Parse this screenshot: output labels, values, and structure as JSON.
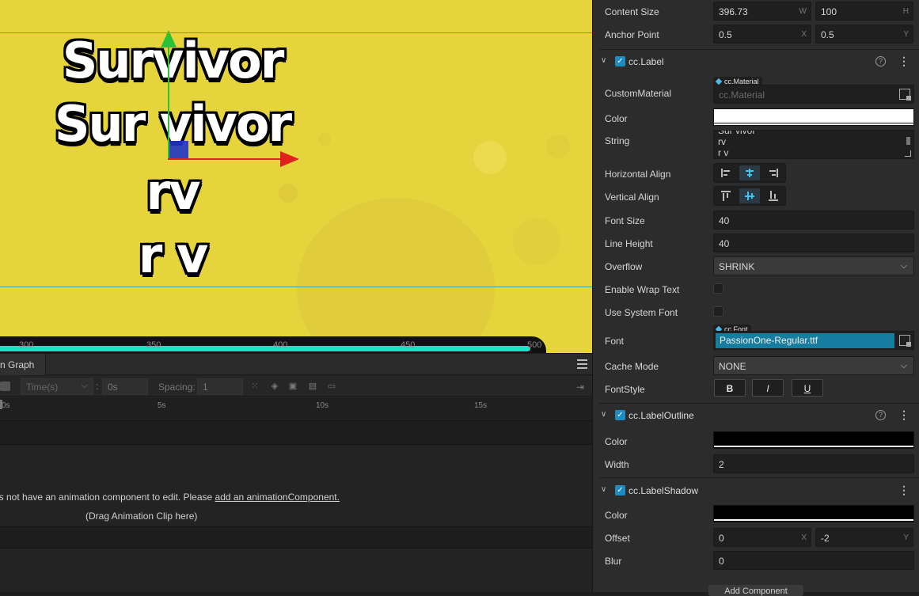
{
  "scene": {
    "label_lines": [
      "Survivor",
      "Sur vivor",
      "rv",
      "r v"
    ],
    "ruler_ticks": [
      "300",
      "350",
      "400",
      "450",
      "500"
    ]
  },
  "animation": {
    "tab_label": "n Graph",
    "time_mode": "Time(s)",
    "time_value": "0s",
    "spacing_label": "Spacing:",
    "spacing_value": "1",
    "timeline_labels": [
      "0s",
      "5s",
      "10s",
      "15s"
    ],
    "message_prefix": "es not have an animation component to edit. Please ",
    "message_link": "add an animationComponent.",
    "drag_hint": "(Drag Animation Clip here)"
  },
  "inspector": {
    "content_size": {
      "label": "Content Size",
      "width": "396.73",
      "width_suffix": "W",
      "height": "100",
      "height_suffix": "H"
    },
    "anchor_point": {
      "label": "Anchor Point",
      "x": "0.5",
      "x_suffix": "X",
      "y": "0.5",
      "y_suffix": "Y"
    },
    "label_component": {
      "title": "cc.Label",
      "custom_material": {
        "label": "CustomMaterial",
        "tag": "cc.Material",
        "value": "cc.Material"
      },
      "color": {
        "label": "Color",
        "value": "#ffffff"
      },
      "string": {
        "label": "String",
        "lines": [
          "Sur vivor",
          "rv",
          "r v"
        ]
      },
      "horizontal_align": {
        "label": "Horizontal Align",
        "selected": "center"
      },
      "vertical_align": {
        "label": "Vertical Align",
        "selected": "center"
      },
      "font_size": {
        "label": "Font Size",
        "value": "40"
      },
      "line_height": {
        "label": "Line Height",
        "value": "40"
      },
      "overflow": {
        "label": "Overflow",
        "value": "SHRINK"
      },
      "enable_wrap_text": {
        "label": "Enable Wrap Text",
        "checked": false
      },
      "use_system_font": {
        "label": "Use System Font",
        "checked": false
      },
      "font": {
        "label": "Font",
        "tag": "cc.Font",
        "value": "PassionOne-Regular.ttf"
      },
      "cache_mode": {
        "label": "Cache Mode",
        "value": "NONE"
      },
      "font_style": {
        "label": "FontStyle",
        "bold": "B",
        "italic": "I",
        "underline": "U"
      }
    },
    "label_outline": {
      "title": "cc.LabelOutline",
      "color": {
        "label": "Color",
        "value": "#000000"
      },
      "width": {
        "label": "Width",
        "value": "2"
      }
    },
    "label_shadow": {
      "title": "cc.LabelShadow",
      "color": {
        "label": "Color",
        "value": "#000000"
      },
      "offset": {
        "label": "Offset",
        "x": "0",
        "x_suffix": "X",
        "y": "-2",
        "y_suffix": "Y"
      },
      "blur": {
        "label": "Blur",
        "value": "0"
      }
    },
    "add_component": "Add Component"
  },
  "colors": {
    "accent": "#1f8cc0",
    "scene_bg": "#e6d43c",
    "font_highlight": "#177da0"
  }
}
